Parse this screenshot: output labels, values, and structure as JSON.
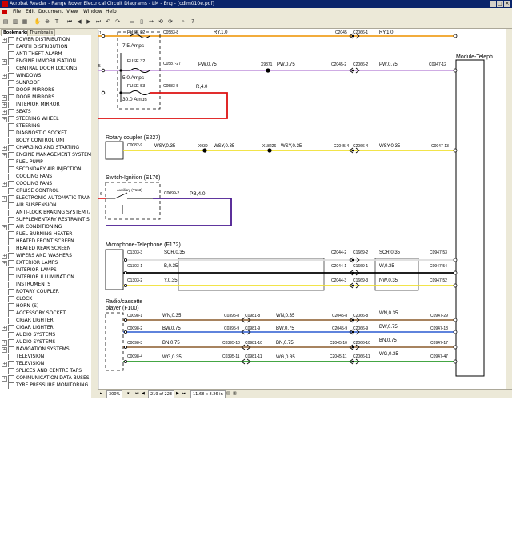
{
  "titlebar": {
    "title": "Acrobat Reader - Range Rover Electrical Circuit Diagrams - LM - Eng - [cdlm010e.pdf]"
  },
  "menu": [
    "File",
    "Edit",
    "Document",
    "View",
    "Window",
    "Help"
  ],
  "sidebar": {
    "tabs": [
      "Bookmarks",
      "Thumbnails"
    ],
    "items": [
      {
        "label": "POWER DISTRIBUTION",
        "exp": true
      },
      {
        "label": "EARTH DISTRIBUTION",
        "exp": false
      },
      {
        "label": "ANTI-THEFT ALARM",
        "exp": false
      },
      {
        "label": "ENGINE IMMOBILISATION",
        "exp": true
      },
      {
        "label": "CENTRAL DOOR LOCKING",
        "exp": false
      },
      {
        "label": "WINDOWS",
        "exp": true
      },
      {
        "label": "SUNROOF",
        "exp": false
      },
      {
        "label": "DOOR MIRRORS",
        "exp": false
      },
      {
        "label": "DOOR MIRRORS",
        "exp": true
      },
      {
        "label": "INTERIOR MIRROR",
        "exp": true
      },
      {
        "label": "SEATS",
        "exp": true
      },
      {
        "label": "STEERING WHEEL",
        "exp": true
      },
      {
        "label": "STEERING",
        "exp": false
      },
      {
        "label": "DIAGNOSTIC SOCKET",
        "exp": false
      },
      {
        "label": "BODY CONTROL UNIT",
        "exp": false
      },
      {
        "label": "CHARGING AND STARTING",
        "exp": true
      },
      {
        "label": "ENGINE MANAGEMENT SYSTEM",
        "exp": true
      },
      {
        "label": "FUEL PUMP",
        "exp": false
      },
      {
        "label": "SECONDARY AIR INJECTION",
        "exp": false
      },
      {
        "label": "COOLING FANS",
        "exp": false
      },
      {
        "label": "COOLING FANS",
        "exp": true
      },
      {
        "label": "CRUISE CONTROL",
        "exp": false
      },
      {
        "label": "ELECTRONIC AUTOMATIC TRAN",
        "exp": true
      },
      {
        "label": "AIR SUSPENSION",
        "exp": false
      },
      {
        "label": "ANTI-LOCK BRAKING SYSTEM (/",
        "exp": false
      },
      {
        "label": "SUPPLEMENTARY RESTRAINT S",
        "exp": false
      },
      {
        "label": "AIR CONDITIONING",
        "exp": true
      },
      {
        "label": "FUEL BURNING HEATER",
        "exp": false
      },
      {
        "label": "HEATED FRONT SCREEN",
        "exp": false
      },
      {
        "label": "HEATED REAR SCREEN",
        "exp": false
      },
      {
        "label": "WIPERS AND WASHERS",
        "exp": true
      },
      {
        "label": "EXTERIOR LAMPS",
        "exp": true
      },
      {
        "label": "INTERIOR LAMPS",
        "exp": false
      },
      {
        "label": "INTERIOR ILLUMINATION",
        "exp": false
      },
      {
        "label": "INSTRUMENTS",
        "exp": false
      },
      {
        "label": "ROTARY COUPLER",
        "exp": false
      },
      {
        "label": "CLOCK",
        "exp": false
      },
      {
        "label": "HORN (S)",
        "exp": false
      },
      {
        "label": "ACCESSORY SOCKET",
        "exp": false
      },
      {
        "label": "CIGAR LIGHTER",
        "exp": false
      },
      {
        "label": "CIGAR LIGHTER",
        "exp": true
      },
      {
        "label": "AUDIO SYSTEMS",
        "exp": false
      },
      {
        "label": "AUDIO SYSTEMS",
        "exp": true
      },
      {
        "label": "NAVIGATION SYSTEMS",
        "exp": true
      },
      {
        "label": "TELEVISION",
        "exp": false
      },
      {
        "label": "TELEVISION",
        "exp": true
      },
      {
        "label": "SPLICES AND CENTRE TAPS",
        "exp": false
      },
      {
        "label": "COMMUNICATION DATA BUSES",
        "exp": true
      },
      {
        "label": "TYRE PRESSURE MONITORING",
        "exp": false
      }
    ]
  },
  "status": {
    "zoom": "300%",
    "page": "219 of 223",
    "size": "11.68 x 8.26 in"
  },
  "diagram": {
    "module_label": "Module-Teleph",
    "fuse22": "FUSE 22",
    "fuse22_amps": "7.5 Amps",
    "fuse32": "FUSE 32",
    "fuse32_amps": "5.0 Amps",
    "fuse53": "FUSE 53",
    "fuse53_amps": "30.0 Amps",
    "c0583_8": "C0583-8",
    "ry10a": "RY,1.0",
    "c2045": "C2045",
    "c2066_1": "C2066-1",
    "ry10b": "RY,1.0",
    "c0587_27": "C0587-27",
    "pw075a": "PW,0.75",
    "x9371": "X9371",
    "pw075b": "PW,0.75",
    "c2045_2": "C2045-2",
    "c2066_2": "C2066-2",
    "pw075c": "PW,0.75",
    "c0947_12": "C0947-12",
    "c0583_5": "C0583-5",
    "r40": "R,4.0",
    "rotary_title": "Rotary coupler (S227)",
    "c0082_9": "C0082-9",
    "wsy1": "WSY,0.35",
    "x939": "X939",
    "wsy2": "WSY,0.35",
    "x18226": "X18226",
    "wsy3": "WSY,0.35",
    "c2045_4": "C2045-4",
    "c2066_4": "C2066-4",
    "wsy4": "WSY,0.35",
    "c0947_13": "C0947-13",
    "switch_title": "Switch-Ignition (S176)",
    "auxiliary": "Auxiliary (Y163)",
    "c0099_2": "C0099-2",
    "pb40": "PB,4.0",
    "mic_title": "Microphone-Telephone (F172)",
    "c1303_3": "C1303-3",
    "scr1": "SCR,0.35",
    "c2044_2": "C2044-2",
    "c1669_2": "C1669-2",
    "scr2": "SCR,0.35",
    "c0947_53": "C0947-53",
    "c1303_1": "C1303-1",
    "b035": "B,0.35",
    "c2044_1": "C2044-1",
    "c1669_1": "C1669-1",
    "w035": "W,0.35",
    "c0947_54": "C0947-54",
    "c1303_2": "C1303-2",
    "y035": "Y,0.35",
    "c2044_3": "C2044-3",
    "c1669_3": "C1669-3",
    "nw035": "NW,0.35",
    "c0947_52": "C0947-52",
    "radio_title1": "Radio/cassette",
    "radio_title2": "player (F100)",
    "c0098_1": "C0098-1",
    "wn1": "WN,0.35",
    "c0395_8": "C0395-8",
    "c0981_8": "C0981-8",
    "wn2": "WN,0.35",
    "c2045_8": "C2045-8",
    "c2066_8": "C2066-8",
    "wn3": "WN,0.35",
    "c0947_29": "C0947-29",
    "c0098_2": "C0098-2",
    "bw1": "BW,0.75",
    "c0395_9": "C0395-9",
    "c0981_9": "C0981-9",
    "bw2": "BW,0.75",
    "c2045_9": "C2045-9",
    "c2066_9": "C2066-9",
    "bw3": "BW,0.75",
    "c0947_18": "C0947-18",
    "c0098_3": "C0098-3",
    "bn1": "BN,0.75",
    "c0395_10": "C0395-10",
    "c0981_10": "C0981-10",
    "bn2": "BN,0.75",
    "c2045_10": "C2045-10",
    "c2066_10": "C2066-10",
    "bn3": "BN,0.75",
    "c0947_17": "C0947-17",
    "c0098_4": "C0098-4",
    "wg1": "WG,0.35",
    "c0395_11": "C0395-11",
    "c0981_11": "C0981-11",
    "wg2": "WG,0.35",
    "c2045_11": "C2045-11",
    "c2066_11": "C2066-11",
    "wg3": "WG,0.35",
    "c0947_47": "C0947-47",
    "pin_1": "1",
    "pin_5": "5",
    "pin_6": "6"
  },
  "colors": {
    "titlebar": "#0a246a",
    "chrome": "#ece9d8",
    "wire_ry": "#f0a020",
    "wire_pw": "#c8a0e0",
    "wire_red": "#dd1111",
    "wire_yellow": "#f0e030",
    "wire_purple": "#4a1a90",
    "wire_black": "#000000",
    "wire_white": "#dddddd",
    "wire_brown": "#8a5a2a",
    "wire_green": "#2a9a2a",
    "wire_blue": "#2a5ad0"
  }
}
